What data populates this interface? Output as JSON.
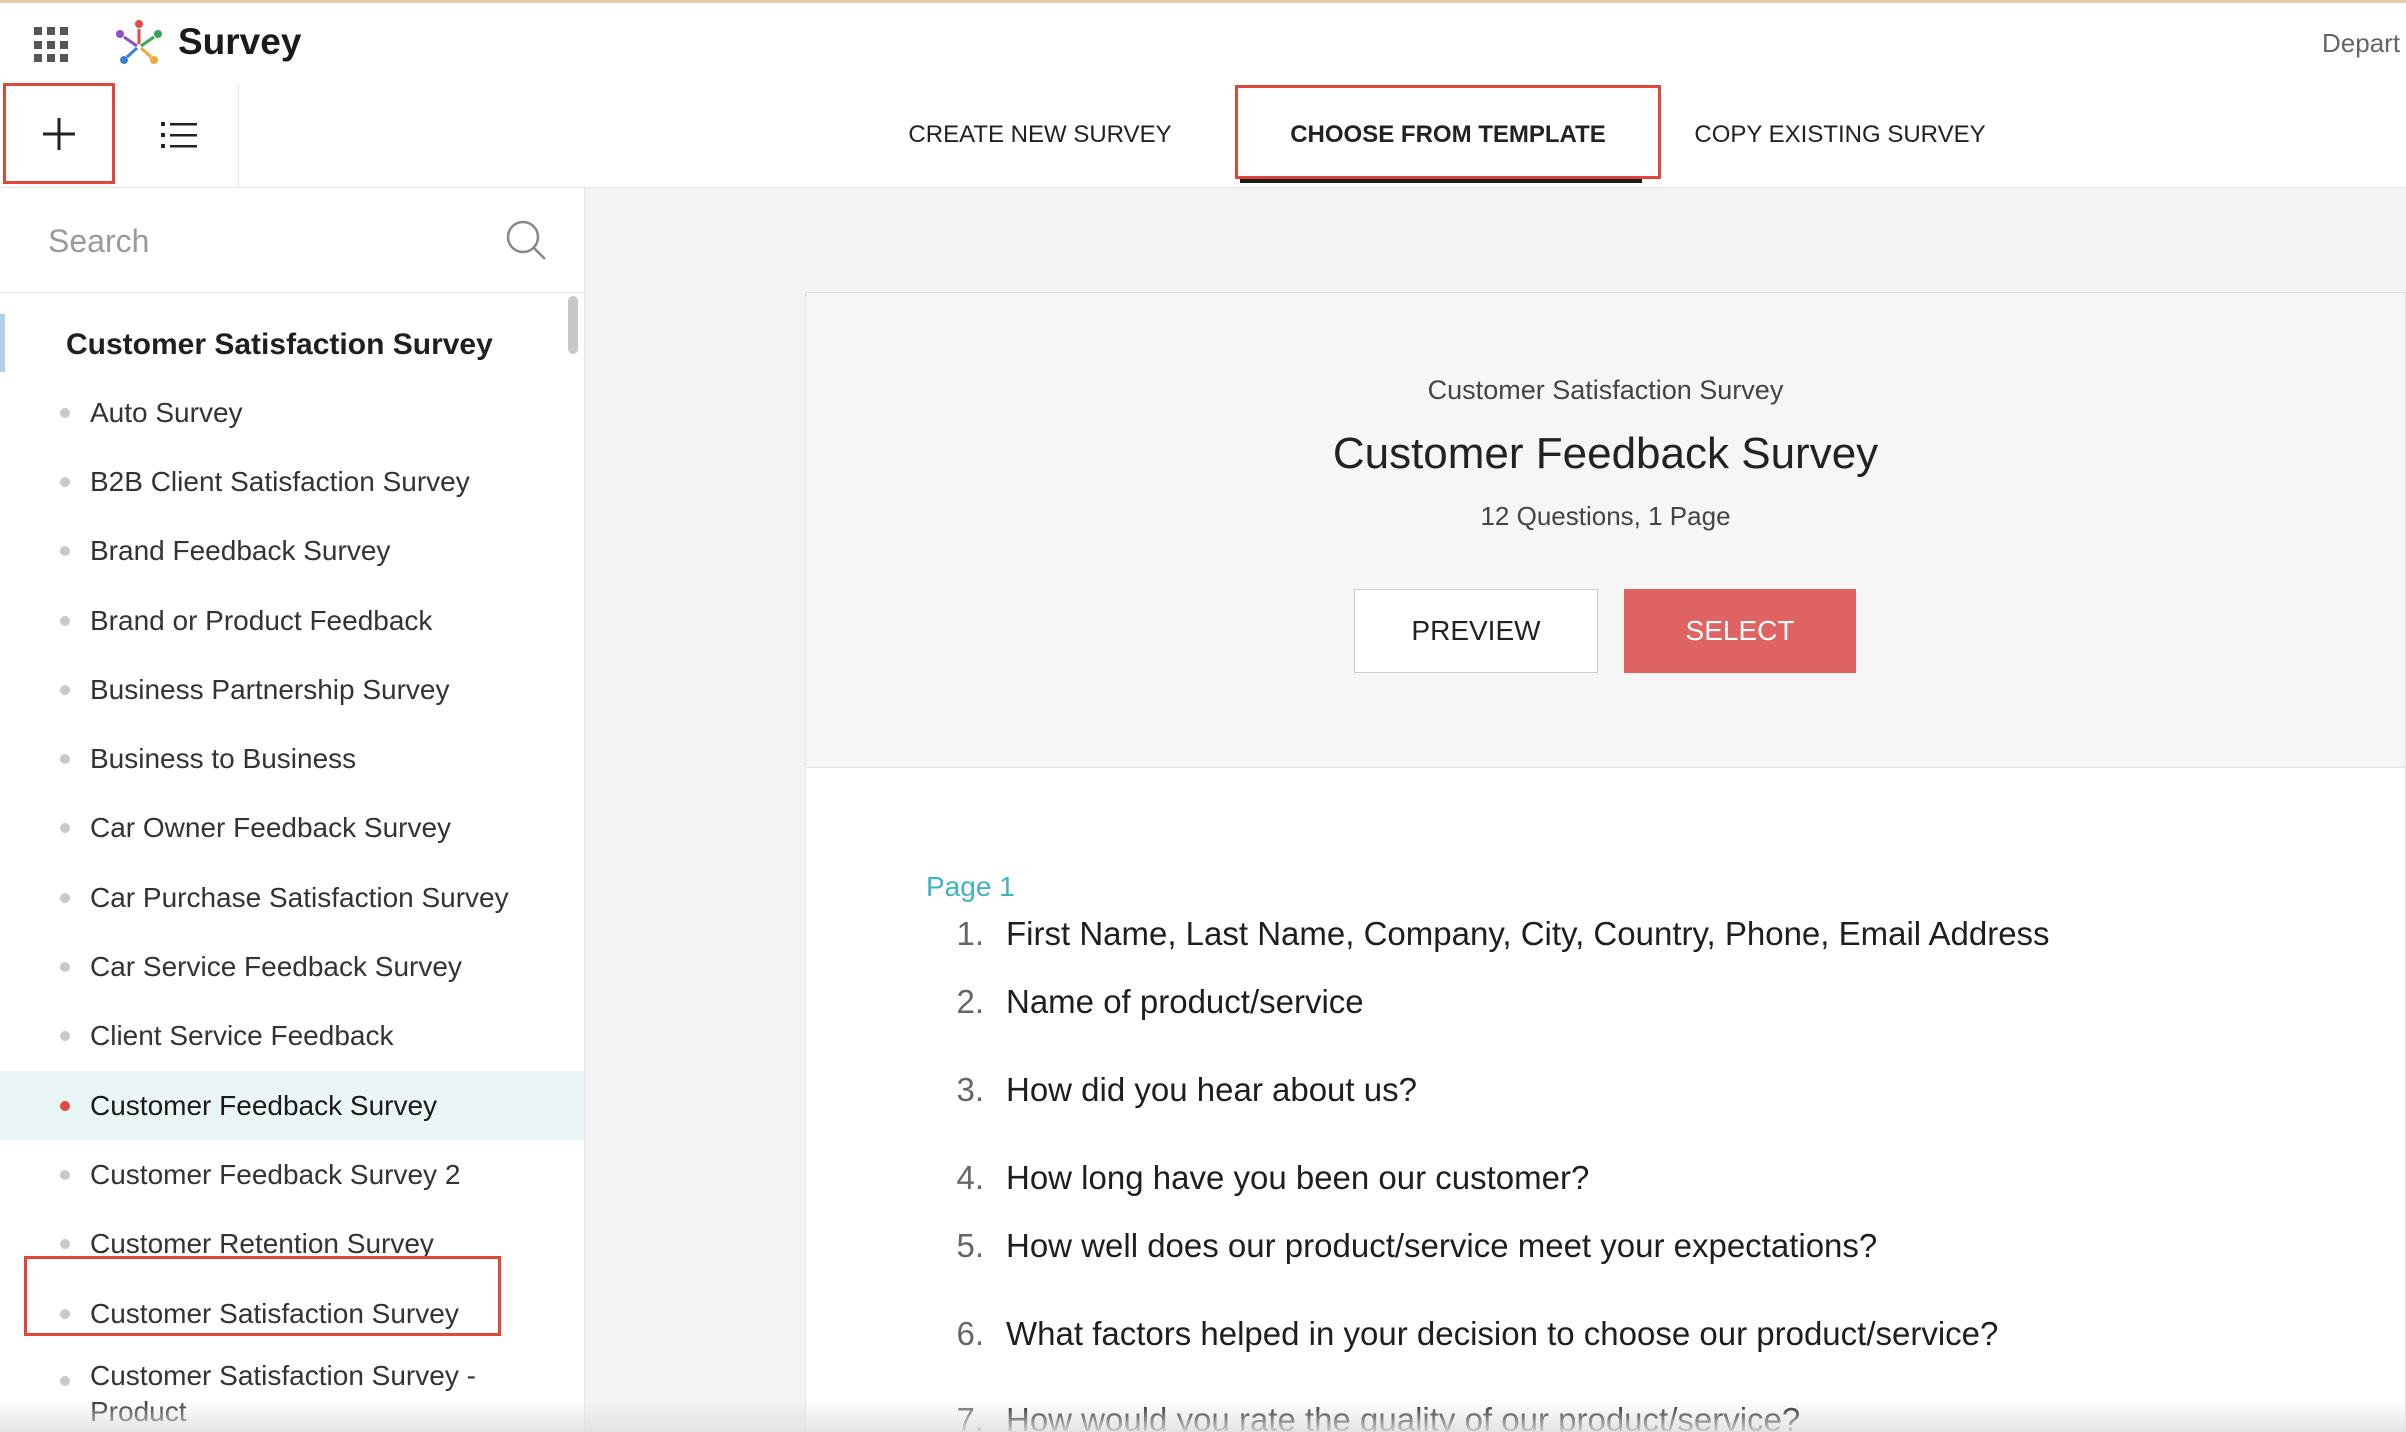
{
  "header": {
    "app_title": "Survey",
    "department_text": "Depart"
  },
  "toolbar": {
    "tabs": [
      {
        "label": "CREATE NEW SURVEY"
      },
      {
        "label": "CHOOSE FROM TEMPLATE",
        "active": true
      },
      {
        "label": "COPY EXISTING SURVEY"
      }
    ]
  },
  "sidebar": {
    "search_placeholder": "Search",
    "group_title": "Customer Satisfaction Survey",
    "items": [
      {
        "label": "Auto Survey"
      },
      {
        "label": "B2B Client Satisfaction Survey"
      },
      {
        "label": "Brand Feedback Survey"
      },
      {
        "label": "Brand or Product Feedback"
      },
      {
        "label": "Business Partnership Survey"
      },
      {
        "label": "Business to Business"
      },
      {
        "label": "Car Owner Feedback Survey"
      },
      {
        "label": "Car Purchase Satisfaction Survey"
      },
      {
        "label": "Car Service Feedback Survey"
      },
      {
        "label": "Client Service Feedback"
      },
      {
        "label": "Customer Feedback Survey",
        "selected": true
      },
      {
        "label": "Customer Feedback Survey 2"
      },
      {
        "label": "Customer Retention Survey"
      },
      {
        "label": "Customer Satisfaction Survey"
      },
      {
        "label": "Customer Satisfaction Survey - Product"
      }
    ]
  },
  "preview": {
    "category": "Customer Satisfaction Survey",
    "title": "Customer Feedback Survey",
    "meta": "12 Questions, 1 Page",
    "preview_label": "PREVIEW",
    "select_label": "SELECT",
    "page_label": "Page 1",
    "questions": [
      {
        "num": "1.",
        "text": "First Name, Last Name, Company, City, Country, Phone, Email Address"
      },
      {
        "num": "2.",
        "text": "Name of product/service"
      },
      {
        "num": "3.",
        "text": "How did you hear about us?"
      },
      {
        "num": "4.",
        "text": "How long have you been our customer?"
      },
      {
        "num": "5.",
        "text": "How well does our product/service meet your expectations?"
      },
      {
        "num": "6.",
        "text": "What factors helped in your decision to choose our product/service?"
      },
      {
        "num": "7.",
        "text": "How would you rate the quality of our product/service?"
      }
    ]
  },
  "colors": {
    "accent_red": "#de6362",
    "highlight_border": "#e0463b",
    "page_label": "#3fb3c2",
    "selected_bg": "#eaf6f6"
  }
}
